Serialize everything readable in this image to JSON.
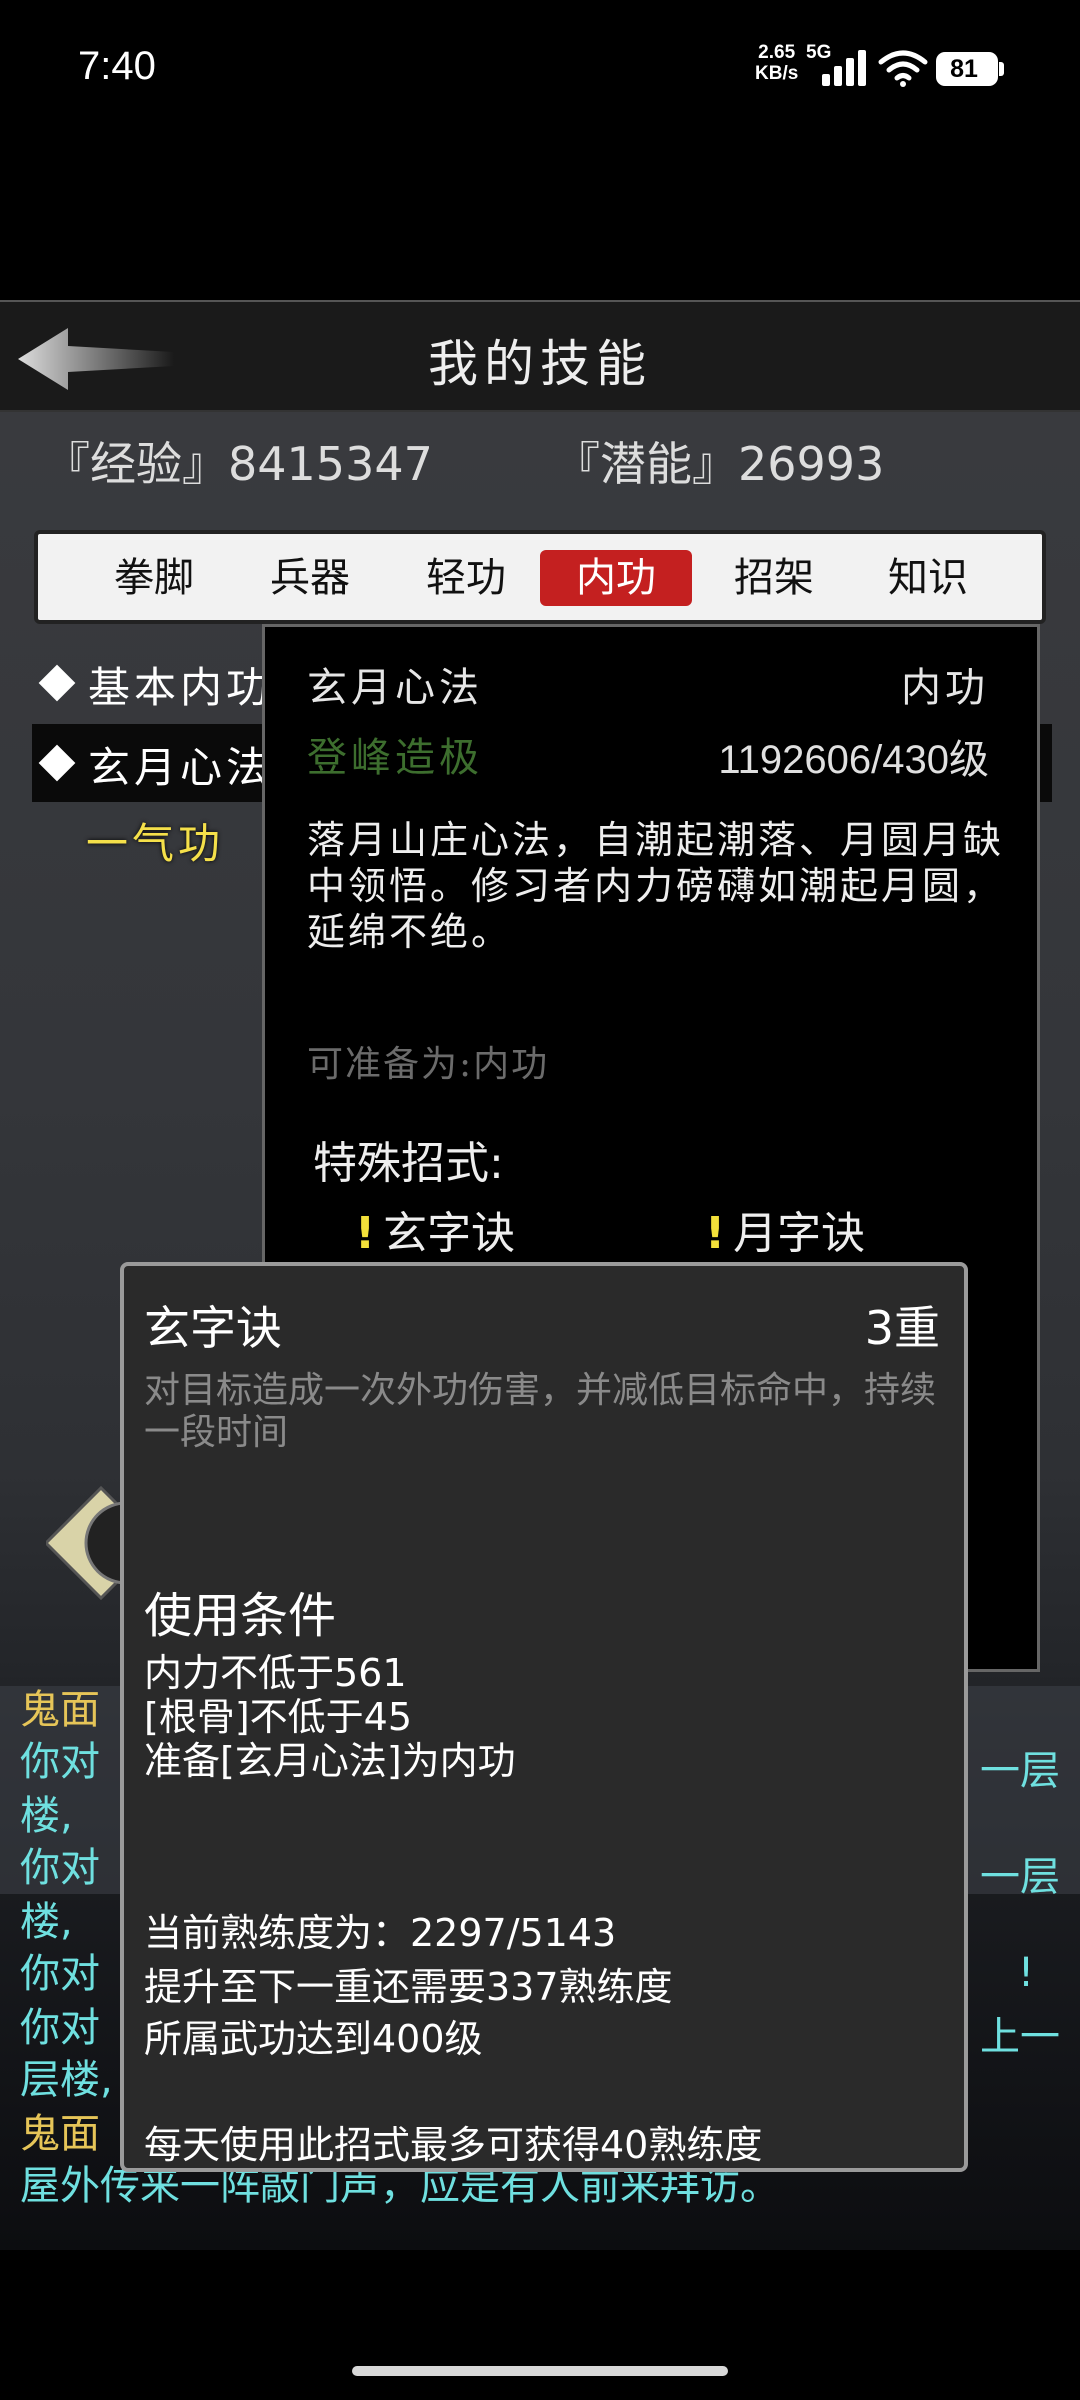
{
  "status_bar": {
    "time": "7:40",
    "speed_value": "2.65",
    "speed_unit": "KB/s",
    "network": "5G",
    "battery": "81"
  },
  "header": {
    "title": "我的技能"
  },
  "stats": {
    "experience": "『经验』8415347",
    "potential": "『潜能』26993"
  },
  "tabs": [
    {
      "label": "拳脚",
      "active": false
    },
    {
      "label": "兵器",
      "active": false
    },
    {
      "label": "轻功",
      "active": false
    },
    {
      "label": "内功",
      "active": true
    },
    {
      "label": "招架",
      "active": false
    },
    {
      "label": "知识",
      "active": false
    }
  ],
  "skills": [
    {
      "label": "基本内功"
    },
    {
      "label": "玄月心法"
    }
  ],
  "sub_skill": "一气功",
  "detail": {
    "name": "玄月心法",
    "type": "内功",
    "rank": "登峰造极",
    "level": "1192606/430级",
    "description": "落月山庄心法，自潮起潮落、月圆月缺中领悟。修习者内力磅礴如潮起月圆，延绵不绝。",
    "prepare": "可准备为:内功",
    "special_title": "特殊招式:",
    "special_moves": [
      "玄字诀",
      "月字诀"
    ],
    "special_mark": "!"
  },
  "log": {
    "lines": [
      {
        "text": "鬼面",
        "color": "gold"
      },
      {
        "text": "你对",
        "color": "cyan"
      },
      {
        "text": "楼,",
        "color": "cyan"
      },
      {
        "text": "你对",
        "color": "cyan"
      },
      {
        "text": "楼,",
        "color": "cyan"
      },
      {
        "text": "你对",
        "color": "cyan"
      },
      {
        "text": "你对",
        "color": "cyan"
      },
      {
        "text": "层楼,",
        "color": "cyan"
      },
      {
        "text": "鬼面",
        "color": "gold"
      },
      {
        "text": "屋外传来一阵敲门声，应是有人前来拜访。",
        "color": "cyan"
      }
    ],
    "right_fragments": [
      "一层",
      "一层",
      "!",
      "上一"
    ]
  },
  "move": {
    "name": "玄字诀",
    "tier": "3重",
    "description": "对目标造成一次外功伤害，并减低目标命中，持续一段时间",
    "conditions_title": "使用条件",
    "conditions": [
      "内力不低于561",
      "[根骨]不低于45",
      "准备[玄月心法]为内功"
    ],
    "progress": [
      "当前熟练度为：2297/5143",
      "提升至下一重还需要337熟练度",
      "所属武功达到400级"
    ],
    "daily_limit": "每天使用此招式最多可获得40熟练度"
  }
}
